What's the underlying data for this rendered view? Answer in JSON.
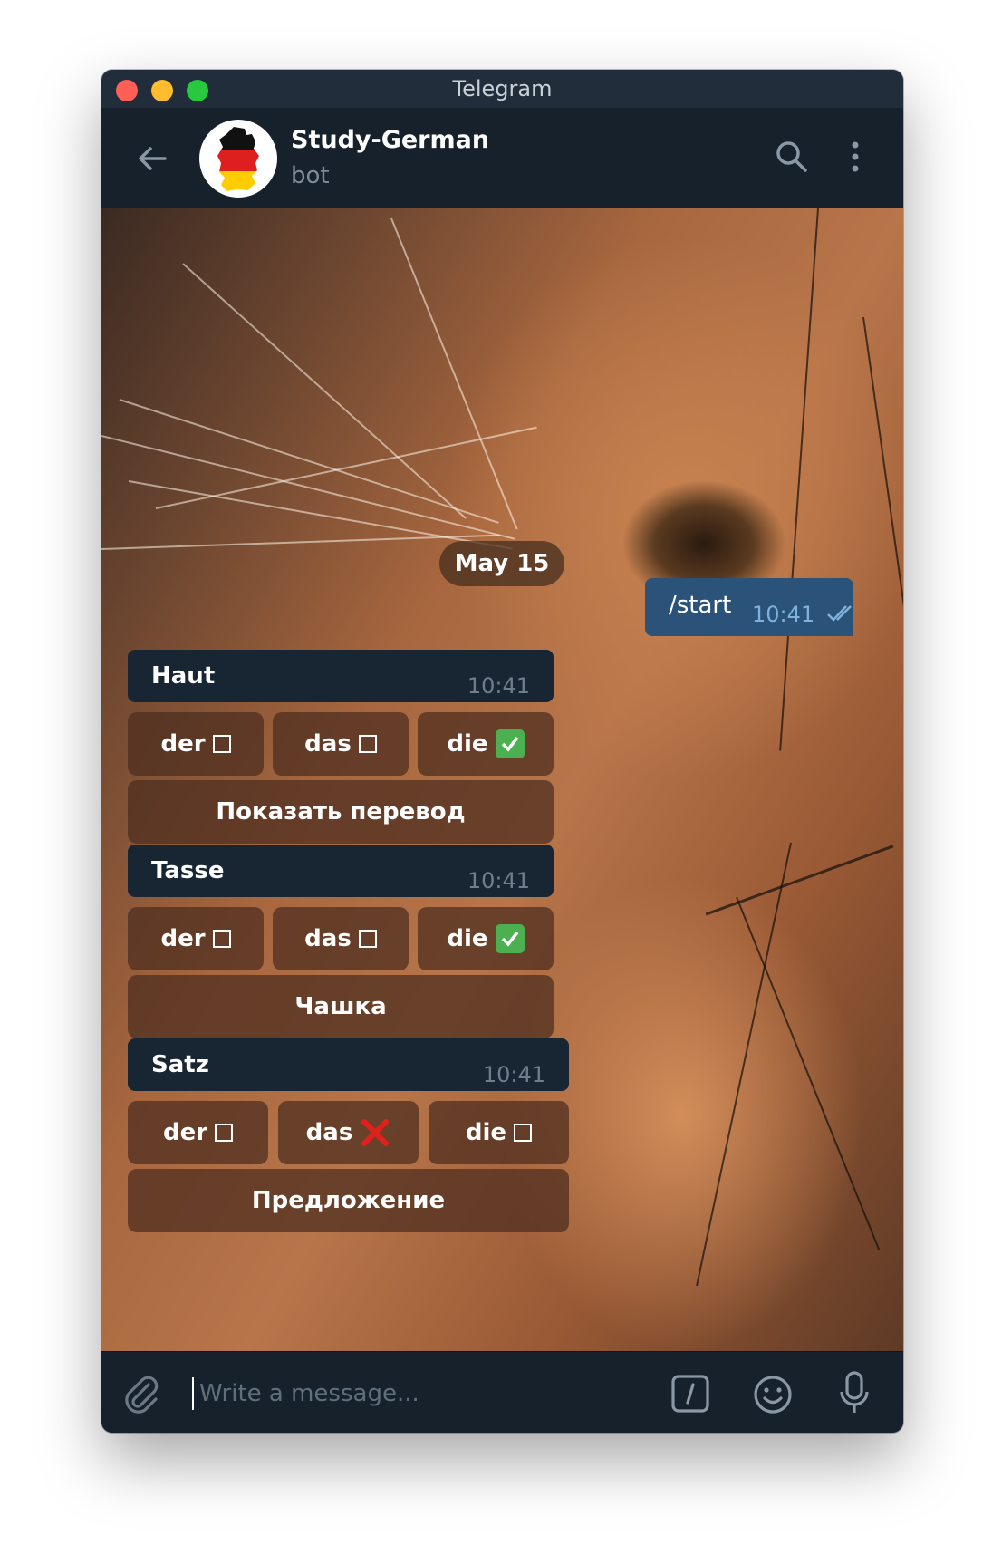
{
  "window": {
    "title": "Telegram"
  },
  "header": {
    "chat_name": "Study-German",
    "chat_subtitle": "bot",
    "avatar": "germany-map-flag",
    "icons": [
      "back-arrow-icon",
      "search-icon",
      "more-vertical-icon"
    ]
  },
  "chat": {
    "date_label": "May 15",
    "outgoing": {
      "text": "/start",
      "time": "10:41",
      "status": "read"
    },
    "cards": [
      {
        "word": "Haut",
        "time": "10:41",
        "options": [
          {
            "label": "der",
            "mark": "empty"
          },
          {
            "label": "das",
            "mark": "empty"
          },
          {
            "label": "die",
            "mark": "correct"
          }
        ],
        "action": "Показать перевод"
      },
      {
        "word": "Tasse",
        "time": "10:41",
        "options": [
          {
            "label": "der",
            "mark": "empty"
          },
          {
            "label": "das",
            "mark": "empty"
          },
          {
            "label": "die",
            "mark": "correct"
          }
        ],
        "action": "Чашка"
      },
      {
        "word": "Satz",
        "time": "10:41",
        "options": [
          {
            "label": "der",
            "mark": "empty"
          },
          {
            "label": "das",
            "mark": "wrong"
          },
          {
            "label": "die",
            "mark": "empty"
          }
        ],
        "action": "Предложение"
      }
    ]
  },
  "composer": {
    "placeholder": "Write a message...",
    "icons": [
      "paperclip-icon",
      "bot-command-icon",
      "emoji-icon",
      "microphone-icon"
    ]
  },
  "colors": {
    "header_bg": "#17212b",
    "outgoing_bubble": "#2b5278",
    "incoming_bubble": "#182533",
    "check_green": "#4cb050",
    "cross_red": "#e0211b"
  }
}
